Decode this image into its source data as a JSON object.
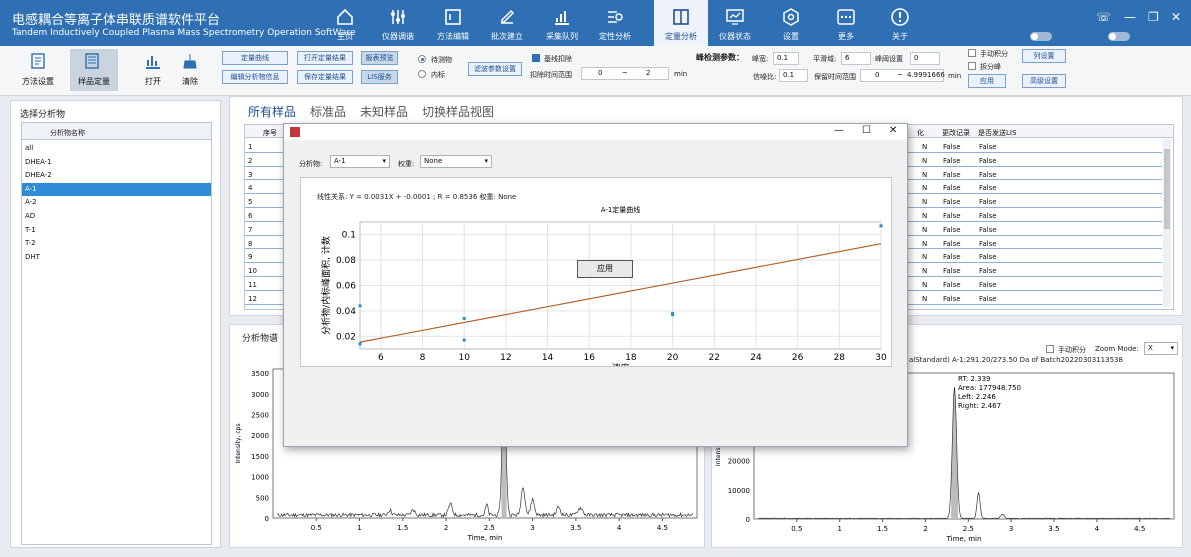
{
  "app": {
    "title_cn": "电感耦合等离子体串联质谱软件平台",
    "title_en": "Tandem Inductively Coupled Plasma Mass Spectrometry Operation SoftWare"
  },
  "nav": [
    {
      "label": "主页",
      "icon": "home-icon"
    },
    {
      "label": "仪器调谐",
      "icon": "tuning-sliders-icon"
    },
    {
      "label": "方法编辑",
      "icon": "method-edit-icon"
    },
    {
      "label": "批次建立",
      "icon": "batch-edit-icon"
    },
    {
      "label": "采集队列",
      "icon": "queue-bar-icon"
    },
    {
      "label": "定性分析",
      "icon": "qualitative-search-icon"
    },
    {
      "label": "定量分析",
      "icon": "quantitative-book-icon"
    },
    {
      "label": "仪器状态",
      "icon": "monitor-chart-icon"
    },
    {
      "label": "设置",
      "icon": "settings-hex-icon"
    },
    {
      "label": "更多",
      "icon": "more-dots-icon"
    },
    {
      "label": "关于",
      "icon": "info-icon"
    }
  ],
  "toolbar": {
    "method_settings": "方法设置",
    "sample_quant": "样品定量",
    "open": "打开",
    "clear": "清除",
    "btn_curve": "定量曲线",
    "btn_open_result": "打开定量结果",
    "btn_preview": "报表预览",
    "btn_edit_analyte": "编辑分析物信息",
    "btn_save_result": "保存定量结果",
    "btn_lis": "LIS服务",
    "radio_analyte": "待测物",
    "radio_internal": "内标",
    "btn_filter": "滤波参数设置",
    "baseline_label": "基线扣除",
    "exclude_range_label": "扣除时间范围",
    "exclude_from": "0",
    "exclude_sep": "~",
    "exclude_to": "2",
    "unit_min": "min",
    "peak_params_label": "峰检测参数：",
    "width_label": "峰宽:",
    "width_val": "0.1",
    "smooth_label": "平滑域:",
    "smooth_val": "6",
    "threshold_label": "峰阈设置",
    "threshold_val": "0",
    "sn_label": "信噪比:",
    "sn_val": "0.1",
    "rt_range_label": "保留时间范围",
    "rt_from": "0",
    "rt_sep": "~",
    "rt_to": "4.9991666",
    "rt_unit": "min",
    "manual_int": "手动积分",
    "split_peak": "拆分峰",
    "apply": "应用",
    "col_settings": "列设置",
    "advanced": "高级设置"
  },
  "left": {
    "title": "选择分析物",
    "header": "分析物名称",
    "items": [
      "all",
      "DHEA-1",
      "DHEA-2",
      "A-1",
      "A-2",
      "AD",
      "T-1",
      "T-2",
      "DHT"
    ],
    "selected": 3
  },
  "tabs": [
    "所有样品",
    "标准品",
    "未知样品",
    "切换样品视图"
  ],
  "table": {
    "col_index": "序号",
    "col_hidden": "化",
    "col_change": "更改记录",
    "col_lis": "是否发送LIS",
    "rows": [
      {
        "n": "1",
        "a": "N",
        "b": "False",
        "c": "False"
      },
      {
        "n": "2",
        "a": "N",
        "b": "False",
        "c": "False"
      },
      {
        "n": "3",
        "a": "N",
        "b": "False",
        "c": "False"
      },
      {
        "n": "4",
        "a": "N",
        "b": "False",
        "c": "False"
      },
      {
        "n": "5",
        "a": "N",
        "b": "False",
        "c": "False"
      },
      {
        "n": "6",
        "a": "N",
        "b": "False",
        "c": "False"
      },
      {
        "n": "7",
        "a": "N",
        "b": "False",
        "c": "False"
      },
      {
        "n": "8",
        "a": "N",
        "b": "False",
        "c": "False"
      },
      {
        "n": "9",
        "a": "N",
        "b": "False",
        "c": "False"
      },
      {
        "n": "10",
        "a": "N",
        "b": "False",
        "c": "False"
      },
      {
        "n": "11",
        "a": "N",
        "b": "False",
        "c": "False"
      },
      {
        "n": "12",
        "a": "N",
        "b": "False",
        "c": "False"
      }
    ]
  },
  "bottom_left": {
    "title": "分析物谱",
    "y_label": "Intensity, cps",
    "x_label": "Time, min",
    "y_ticks": [
      "3500",
      "3000",
      "2500",
      "2000",
      "1500",
      "1000",
      "500",
      "0"
    ],
    "x_ticks": [
      "0.5",
      "1",
      "1.5",
      "2",
      "2.5",
      "3",
      "3.5",
      "4",
      "4.5"
    ]
  },
  "bottom_right": {
    "title_frag": "alStandard) A-1:291.20/273.50 Da of Batch20220303113538",
    "manual": "手动积分",
    "zoom_label": "Zoom Mode:",
    "zoom_val": "X",
    "y_label": "Intensity, cps",
    "x_label": "Time, min",
    "y_ticks": [
      "40000",
      "30000",
      "20000",
      "10000",
      "0"
    ],
    "x_ticks": [
      "0.5",
      "1",
      "1.5",
      "2",
      "2.5",
      "3",
      "3.5",
      "4",
      "4.5"
    ],
    "ann_rt": "RT: 2.339",
    "ann_area": "Area: 177948.750",
    "ann_left": "Left: 2.246",
    "ann_right": "Right: 2.467"
  },
  "dialog": {
    "analyte_label": "分析物:",
    "analyte_val": "A-1",
    "weight_label": "权重:",
    "weight_val": "None",
    "info": "线性关系:  Y = 0.0031X + -0.0001 ; R = 0.8536  权重:   None",
    "apply": "应用"
  },
  "chart_data": {
    "type": "scatter",
    "title": "A-1定量曲线",
    "xlabel": "浓度",
    "ylabel": "分析物/内标峰面积, 计数",
    "xlim": [
      5,
      30
    ],
    "ylim": [
      0.01,
      0.11
    ],
    "x_ticks": [
      6,
      8,
      10,
      12,
      14,
      16,
      18,
      20,
      22,
      24,
      26,
      28,
      30
    ],
    "y_ticks": [
      0.02,
      0.04,
      0.06,
      0.08,
      0.1
    ],
    "points": [
      {
        "x": 5,
        "y": 0.044
      },
      {
        "x": 5,
        "y": 0.014
      },
      {
        "x": 10,
        "y": 0.034
      },
      {
        "x": 10,
        "y": 0.017
      },
      {
        "x": 20,
        "y": 0.038
      },
      {
        "x": 20,
        "y": 0.037
      },
      {
        "x": 30,
        "y": 0.107
      }
    ],
    "fit": {
      "slope": 0.0031,
      "intercept": -0.0001,
      "color": "#b0622a"
    },
    "point_color": "#2f8bd6"
  }
}
